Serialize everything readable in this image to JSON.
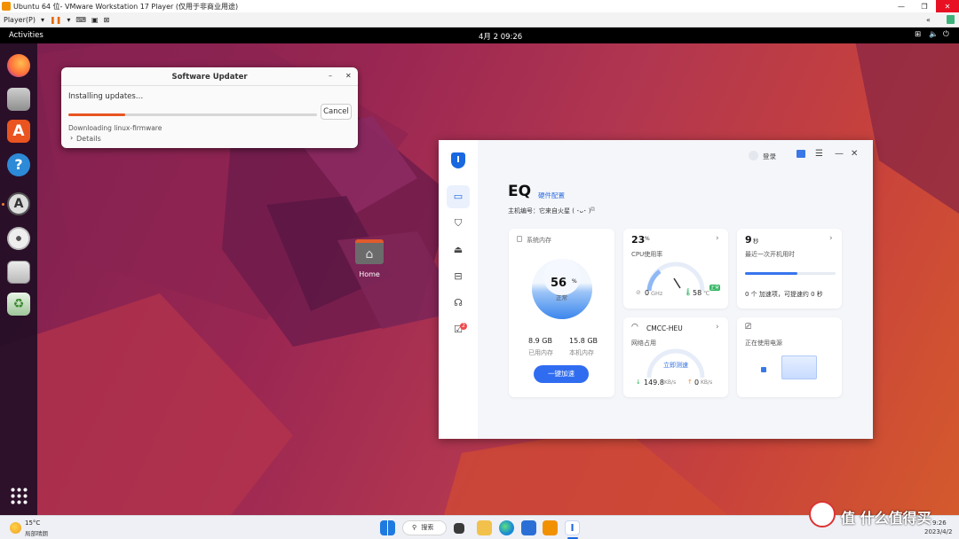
{
  "vm": {
    "title": "Ubuntu 64 位- VMware Workstation 17 Player (仅用于非商业用途)",
    "player_menu": "Player(P)"
  },
  "ubuntu": {
    "activities": "Activities",
    "clock": "4月 2  09:26",
    "home_label": "Home"
  },
  "updater": {
    "title": "Software Updater",
    "status": "Installing updates…",
    "progress": 0.23,
    "cancel": "Cancel",
    "downloading": "Downloading linux-firmware",
    "details": "Details"
  },
  "eq": {
    "login": "登录",
    "title": "EQ",
    "hw_config": "硬件配置",
    "host_name": "主机编号：它来自火星 ( ･ᴗ･ )",
    "memory": {
      "label": "系统内存",
      "percent": "56",
      "unit": "%",
      "state": "正常",
      "used_val": "8.9 GB",
      "used_lbl": "已用内存",
      "total_val": "15.8 GB",
      "total_lbl": "本机内存",
      "button": "一键加速"
    },
    "cpu": {
      "value": "23",
      "unit": "%",
      "label": "CPU使用率",
      "ghz": "0",
      "ghz_unit": "GHz",
      "temp": "58",
      "temp_unit": "℃",
      "badge": "正常"
    },
    "boot": {
      "value": "9",
      "unit": "秒",
      "label": "最近一次开机用时",
      "progress": 0.58,
      "footer": "0 个 加速项，可提速约 0 秒"
    },
    "net": {
      "name": "CMCC-HEU",
      "label": "网络占用",
      "test": "立即测速",
      "down": "149.8",
      "down_unit": "KB/s",
      "up": "0",
      "up_unit": "KB/s"
    },
    "power": {
      "label": "正在使用电源"
    },
    "badge_count": "2"
  },
  "taskbar": {
    "temp": "15°C",
    "weather": "局部晴朗",
    "search": "搜索",
    "time": "9:26",
    "date": "2023/4/2"
  },
  "watermark": "值 什么值得买"
}
